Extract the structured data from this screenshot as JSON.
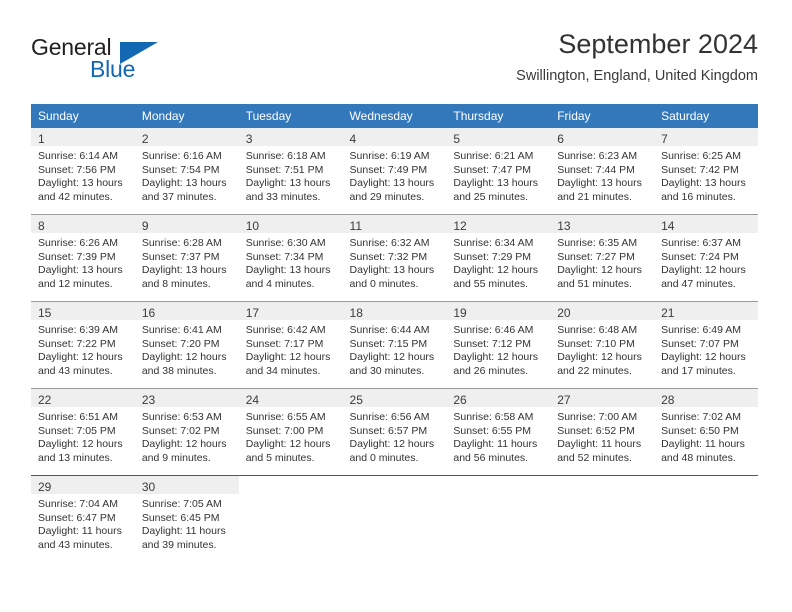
{
  "brand": {
    "name_part1": "General",
    "name_part2": "Blue",
    "accent_color": "#1268b3"
  },
  "header": {
    "month_title": "September 2024",
    "location": "Swillington, England, United Kingdom",
    "header_bg_color": "#3478bc"
  },
  "calendar": {
    "weekday_headers": [
      "Sunday",
      "Monday",
      "Tuesday",
      "Wednesday",
      "Thursday",
      "Friday",
      "Saturday"
    ],
    "labels": {
      "sunrise": "Sunrise:",
      "sunset": "Sunset:",
      "daylight": "Daylight:"
    },
    "weeks": [
      [
        {
          "day": "1",
          "sunrise": "Sunrise: 6:14 AM",
          "sunset": "Sunset: 7:56 PM",
          "daylight_line1": "Daylight: 13 hours",
          "daylight_line2": "and 42 minutes."
        },
        {
          "day": "2",
          "sunrise": "Sunrise: 6:16 AM",
          "sunset": "Sunset: 7:54 PM",
          "daylight_line1": "Daylight: 13 hours",
          "daylight_line2": "and 37 minutes."
        },
        {
          "day": "3",
          "sunrise": "Sunrise: 6:18 AM",
          "sunset": "Sunset: 7:51 PM",
          "daylight_line1": "Daylight: 13 hours",
          "daylight_line2": "and 33 minutes."
        },
        {
          "day": "4",
          "sunrise": "Sunrise: 6:19 AM",
          "sunset": "Sunset: 7:49 PM",
          "daylight_line1": "Daylight: 13 hours",
          "daylight_line2": "and 29 minutes."
        },
        {
          "day": "5",
          "sunrise": "Sunrise: 6:21 AM",
          "sunset": "Sunset: 7:47 PM",
          "daylight_line1": "Daylight: 13 hours",
          "daylight_line2": "and 25 minutes."
        },
        {
          "day": "6",
          "sunrise": "Sunrise: 6:23 AM",
          "sunset": "Sunset: 7:44 PM",
          "daylight_line1": "Daylight: 13 hours",
          "daylight_line2": "and 21 minutes."
        },
        {
          "day": "7",
          "sunrise": "Sunrise: 6:25 AM",
          "sunset": "Sunset: 7:42 PM",
          "daylight_line1": "Daylight: 13 hours",
          "daylight_line2": "and 16 minutes."
        }
      ],
      [
        {
          "day": "8",
          "sunrise": "Sunrise: 6:26 AM",
          "sunset": "Sunset: 7:39 PM",
          "daylight_line1": "Daylight: 13 hours",
          "daylight_line2": "and 12 minutes."
        },
        {
          "day": "9",
          "sunrise": "Sunrise: 6:28 AM",
          "sunset": "Sunset: 7:37 PM",
          "daylight_line1": "Daylight: 13 hours",
          "daylight_line2": "and 8 minutes."
        },
        {
          "day": "10",
          "sunrise": "Sunrise: 6:30 AM",
          "sunset": "Sunset: 7:34 PM",
          "daylight_line1": "Daylight: 13 hours",
          "daylight_line2": "and 4 minutes."
        },
        {
          "day": "11",
          "sunrise": "Sunrise: 6:32 AM",
          "sunset": "Sunset: 7:32 PM",
          "daylight_line1": "Daylight: 13 hours",
          "daylight_line2": "and 0 minutes."
        },
        {
          "day": "12",
          "sunrise": "Sunrise: 6:34 AM",
          "sunset": "Sunset: 7:29 PM",
          "daylight_line1": "Daylight: 12 hours",
          "daylight_line2": "and 55 minutes."
        },
        {
          "day": "13",
          "sunrise": "Sunrise: 6:35 AM",
          "sunset": "Sunset: 7:27 PM",
          "daylight_line1": "Daylight: 12 hours",
          "daylight_line2": "and 51 minutes."
        },
        {
          "day": "14",
          "sunrise": "Sunrise: 6:37 AM",
          "sunset": "Sunset: 7:24 PM",
          "daylight_line1": "Daylight: 12 hours",
          "daylight_line2": "and 47 minutes."
        }
      ],
      [
        {
          "day": "15",
          "sunrise": "Sunrise: 6:39 AM",
          "sunset": "Sunset: 7:22 PM",
          "daylight_line1": "Daylight: 12 hours",
          "daylight_line2": "and 43 minutes."
        },
        {
          "day": "16",
          "sunrise": "Sunrise: 6:41 AM",
          "sunset": "Sunset: 7:20 PM",
          "daylight_line1": "Daylight: 12 hours",
          "daylight_line2": "and 38 minutes."
        },
        {
          "day": "17",
          "sunrise": "Sunrise: 6:42 AM",
          "sunset": "Sunset: 7:17 PM",
          "daylight_line1": "Daylight: 12 hours",
          "daylight_line2": "and 34 minutes."
        },
        {
          "day": "18",
          "sunrise": "Sunrise: 6:44 AM",
          "sunset": "Sunset: 7:15 PM",
          "daylight_line1": "Daylight: 12 hours",
          "daylight_line2": "and 30 minutes."
        },
        {
          "day": "19",
          "sunrise": "Sunrise: 6:46 AM",
          "sunset": "Sunset: 7:12 PM",
          "daylight_line1": "Daylight: 12 hours",
          "daylight_line2": "and 26 minutes."
        },
        {
          "day": "20",
          "sunrise": "Sunrise: 6:48 AM",
          "sunset": "Sunset: 7:10 PM",
          "daylight_line1": "Daylight: 12 hours",
          "daylight_line2": "and 22 minutes."
        },
        {
          "day": "21",
          "sunrise": "Sunrise: 6:49 AM",
          "sunset": "Sunset: 7:07 PM",
          "daylight_line1": "Daylight: 12 hours",
          "daylight_line2": "and 17 minutes."
        }
      ],
      [
        {
          "day": "22",
          "sunrise": "Sunrise: 6:51 AM",
          "sunset": "Sunset: 7:05 PM",
          "daylight_line1": "Daylight: 12 hours",
          "daylight_line2": "and 13 minutes."
        },
        {
          "day": "23",
          "sunrise": "Sunrise: 6:53 AM",
          "sunset": "Sunset: 7:02 PM",
          "daylight_line1": "Daylight: 12 hours",
          "daylight_line2": "and 9 minutes."
        },
        {
          "day": "24",
          "sunrise": "Sunrise: 6:55 AM",
          "sunset": "Sunset: 7:00 PM",
          "daylight_line1": "Daylight: 12 hours",
          "daylight_line2": "and 5 minutes."
        },
        {
          "day": "25",
          "sunrise": "Sunrise: 6:56 AM",
          "sunset": "Sunset: 6:57 PM",
          "daylight_line1": "Daylight: 12 hours",
          "daylight_line2": "and 0 minutes."
        },
        {
          "day": "26",
          "sunrise": "Sunrise: 6:58 AM",
          "sunset": "Sunset: 6:55 PM",
          "daylight_line1": "Daylight: 11 hours",
          "daylight_line2": "and 56 minutes."
        },
        {
          "day": "27",
          "sunrise": "Sunrise: 7:00 AM",
          "sunset": "Sunset: 6:52 PM",
          "daylight_line1": "Daylight: 11 hours",
          "daylight_line2": "and 52 minutes."
        },
        {
          "day": "28",
          "sunrise": "Sunrise: 7:02 AM",
          "sunset": "Sunset: 6:50 PM",
          "daylight_line1": "Daylight: 11 hours",
          "daylight_line2": "and 48 minutes."
        }
      ],
      [
        {
          "day": "29",
          "sunrise": "Sunrise: 7:04 AM",
          "sunset": "Sunset: 6:47 PM",
          "daylight_line1": "Daylight: 11 hours",
          "daylight_line2": "and 43 minutes."
        },
        {
          "day": "30",
          "sunrise": "Sunrise: 7:05 AM",
          "sunset": "Sunset: 6:45 PM",
          "daylight_line1": "Daylight: 11 hours",
          "daylight_line2": "and 39 minutes."
        },
        {
          "day": "",
          "sunrise": "",
          "sunset": "",
          "daylight_line1": "",
          "daylight_line2": ""
        },
        {
          "day": "",
          "sunrise": "",
          "sunset": "",
          "daylight_line1": "",
          "daylight_line2": ""
        },
        {
          "day": "",
          "sunrise": "",
          "sunset": "",
          "daylight_line1": "",
          "daylight_line2": ""
        },
        {
          "day": "",
          "sunrise": "",
          "sunset": "",
          "daylight_line1": "",
          "daylight_line2": ""
        },
        {
          "day": "",
          "sunrise": "",
          "sunset": "",
          "daylight_line1": "",
          "daylight_line2": ""
        }
      ]
    ]
  }
}
